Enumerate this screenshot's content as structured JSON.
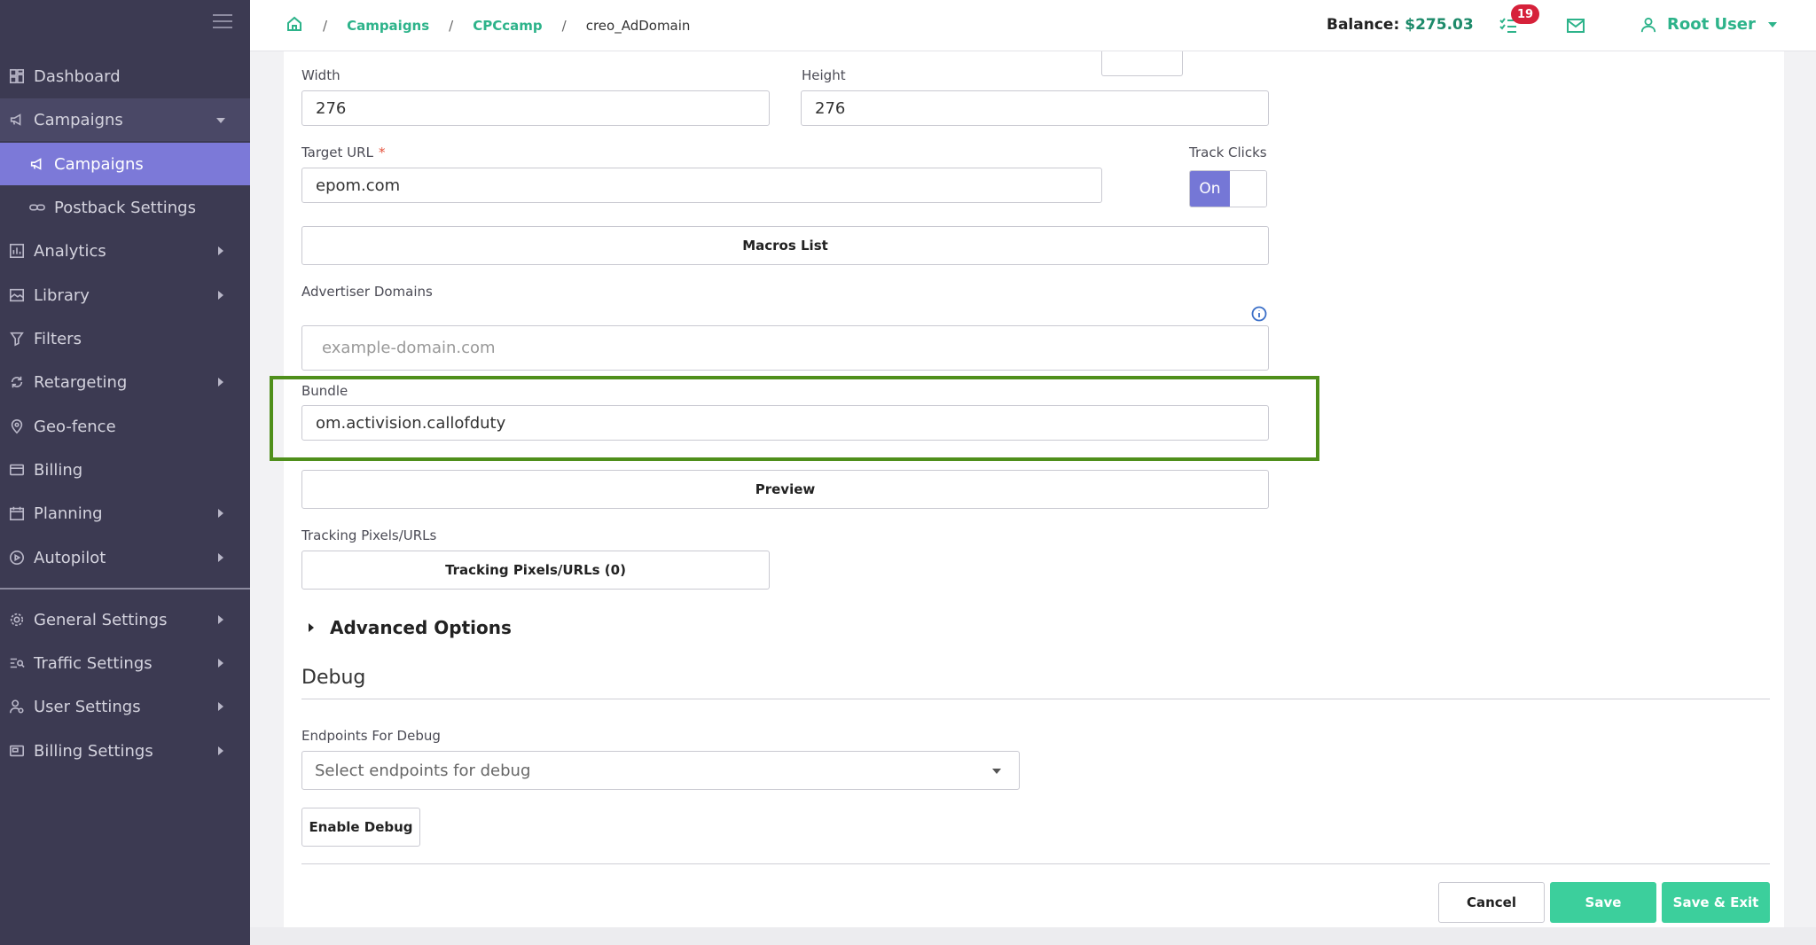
{
  "header": {
    "breadcrumbs": {
      "campaigns": "Campaigns",
      "campaign": "CPCcamp",
      "current": "creo_AdDomain",
      "separator": "/"
    },
    "balance_label": "Balance:",
    "balance_value": "$275.03",
    "tasks_count": "19",
    "user_name": "Root User"
  },
  "sidebar": {
    "items": [
      {
        "label": "Dashboard",
        "icon": "dashboard-icon"
      },
      {
        "label": "Campaigns",
        "icon": "megaphone-icon"
      },
      {
        "label": "Campaigns",
        "icon": "megaphone-icon"
      },
      {
        "label": "Postback Settings",
        "icon": "link-icon"
      },
      {
        "label": "Analytics",
        "icon": "analytics-icon"
      },
      {
        "label": "Library",
        "icon": "library-icon"
      },
      {
        "label": "Filters",
        "icon": "filter-icon"
      },
      {
        "label": "Retargeting",
        "icon": "retargeting-icon"
      },
      {
        "label": "Geo-fence",
        "icon": "map-pin-icon"
      },
      {
        "label": "Billing",
        "icon": "credit-card-icon"
      },
      {
        "label": "Planning",
        "icon": "calendar-icon"
      },
      {
        "label": "Autopilot",
        "icon": "play-circle-icon"
      },
      {
        "label": "General Settings",
        "icon": "gear-icon"
      },
      {
        "label": "Traffic Settings",
        "icon": "traffic-icon"
      },
      {
        "label": "User Settings",
        "icon": "user-settings-icon"
      },
      {
        "label": "Billing Settings",
        "icon": "billing-settings-icon"
      }
    ]
  },
  "form": {
    "width_label": "Width",
    "width_value": "276",
    "height_label": "Height",
    "height_value": "276",
    "target_url_label": "Target URL",
    "required_mark": "*",
    "target_url_value": "epom.com",
    "track_clicks_label": "Track Clicks",
    "track_clicks_state": "On",
    "macros_button": "Macros List",
    "advertiser_domains_label": "Advertiser Domains",
    "advertiser_domains_placeholder": "example-domain.com",
    "bundle_label": "Bundle",
    "bundle_value": "om.activision.callofduty",
    "preview_button": "Preview",
    "tracking_label": "Tracking Pixels/URLs",
    "tracking_button": "Tracking Pixels/URLs (0)",
    "advanced_options": "Advanced Options",
    "debug_title": "Debug",
    "endpoints_label": "Endpoints For Debug",
    "endpoints_placeholder": "Select endpoints for debug",
    "enable_debug_button": "Enable Debug"
  },
  "footer": {
    "cancel": "Cancel",
    "save": "Save",
    "save_exit": "Save & Exit"
  },
  "colors": {
    "sidebar_bg": "#3c3a52",
    "active_item": "#7c79d8",
    "accent_green": "#2db38a",
    "button_green": "#3ccf9c",
    "highlight_border": "#4f8f1b",
    "toggle_on": "#7577d6"
  }
}
